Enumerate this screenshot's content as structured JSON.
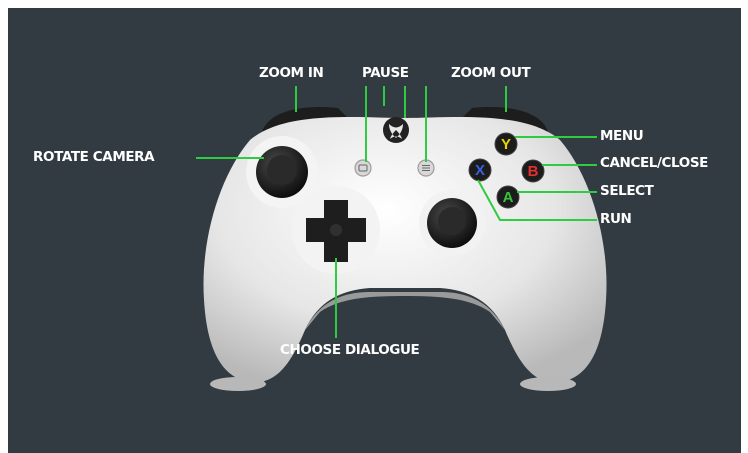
{
  "labels": {
    "zoom_in": "ZOOM IN",
    "pause": "PAUSE",
    "zoom_out": "ZOOM OUT",
    "rotate_camera": "ROTATE CAMERA",
    "menu": "MENU",
    "cancel_close": "CANCEL/CLOSE",
    "select": "SELECT",
    "run": "RUN",
    "choose_dialogue": "CHOOSE DIALOGUE"
  },
  "face_buttons": {
    "y": "Y",
    "b": "B",
    "a": "A",
    "x": "X"
  },
  "colors": {
    "background": "#323b41",
    "callout_line": "#2ecc40",
    "controller_body": "#e8e8e8",
    "y_button": "#e8d400",
    "b_button": "#e03030",
    "a_button": "#3ac43a",
    "x_button": "#3a60e0"
  }
}
